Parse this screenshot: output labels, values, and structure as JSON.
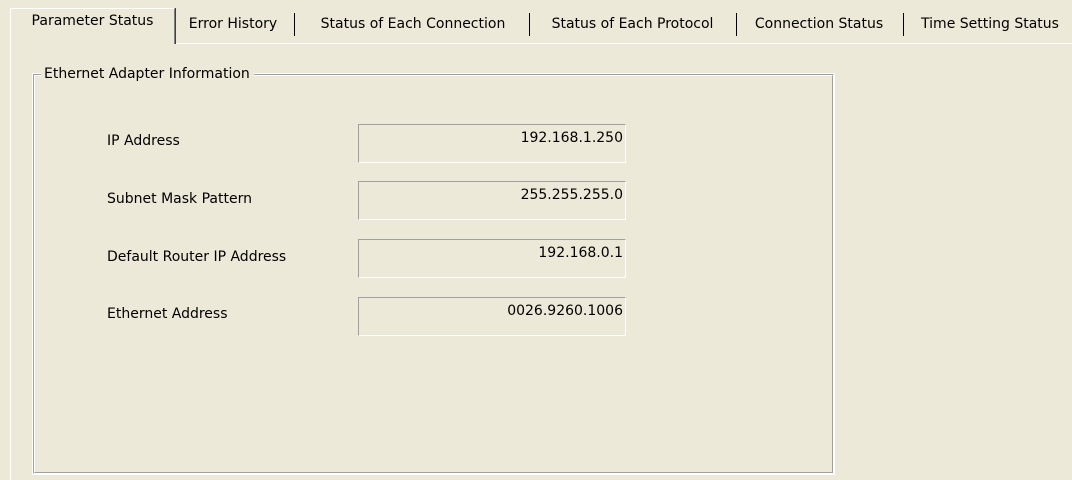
{
  "tabs": [
    {
      "label": "Parameter Status",
      "active": true
    },
    {
      "label": "Error History",
      "active": false
    },
    {
      "label": "Status of Each Connection",
      "active": false
    },
    {
      "label": "Status of Each Protocol",
      "active": false
    },
    {
      "label": "Connection Status",
      "active": false
    },
    {
      "label": "Time Setting Status",
      "active": false
    }
  ],
  "group": {
    "title": "Ethernet Adapter Information",
    "fields": [
      {
        "label": "IP Address",
        "value": "192.168.1.250"
      },
      {
        "label": "Subnet Mask Pattern",
        "value": "255.255.255.0"
      },
      {
        "label": "Default Router IP Address",
        "value": "192.168.0.1"
      },
      {
        "label": "Ethernet Address",
        "value": "0026.9260.1006"
      }
    ]
  },
  "colors": {
    "background": "#ECE9D8",
    "highlight": "#FFFFFF",
    "shadow": "#A0A0A0",
    "text": "#000000"
  }
}
